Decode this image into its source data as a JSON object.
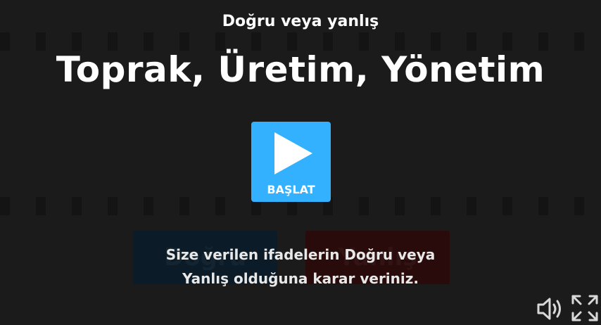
{
  "activity": {
    "type_label": "Doğru veya yanlış",
    "title": "Toprak, Üretim, Yönetim"
  },
  "start_button": {
    "label": "BAŞLAT",
    "icon": "play-icon",
    "color": "#33b1ff"
  },
  "answers": {
    "true_label": "Doğru",
    "false_label": "Yanlış"
  },
  "instructions": {
    "line1": "Size verilen ifadelerin Doğru veya",
    "line2": "Yanlış olduğuna karar veriniz."
  },
  "controls": {
    "volume_icon": "volume-icon",
    "fullscreen_icon": "fullscreen-icon"
  },
  "colors": {
    "background": "#1b1b1b",
    "accent": "#33b1ff"
  }
}
